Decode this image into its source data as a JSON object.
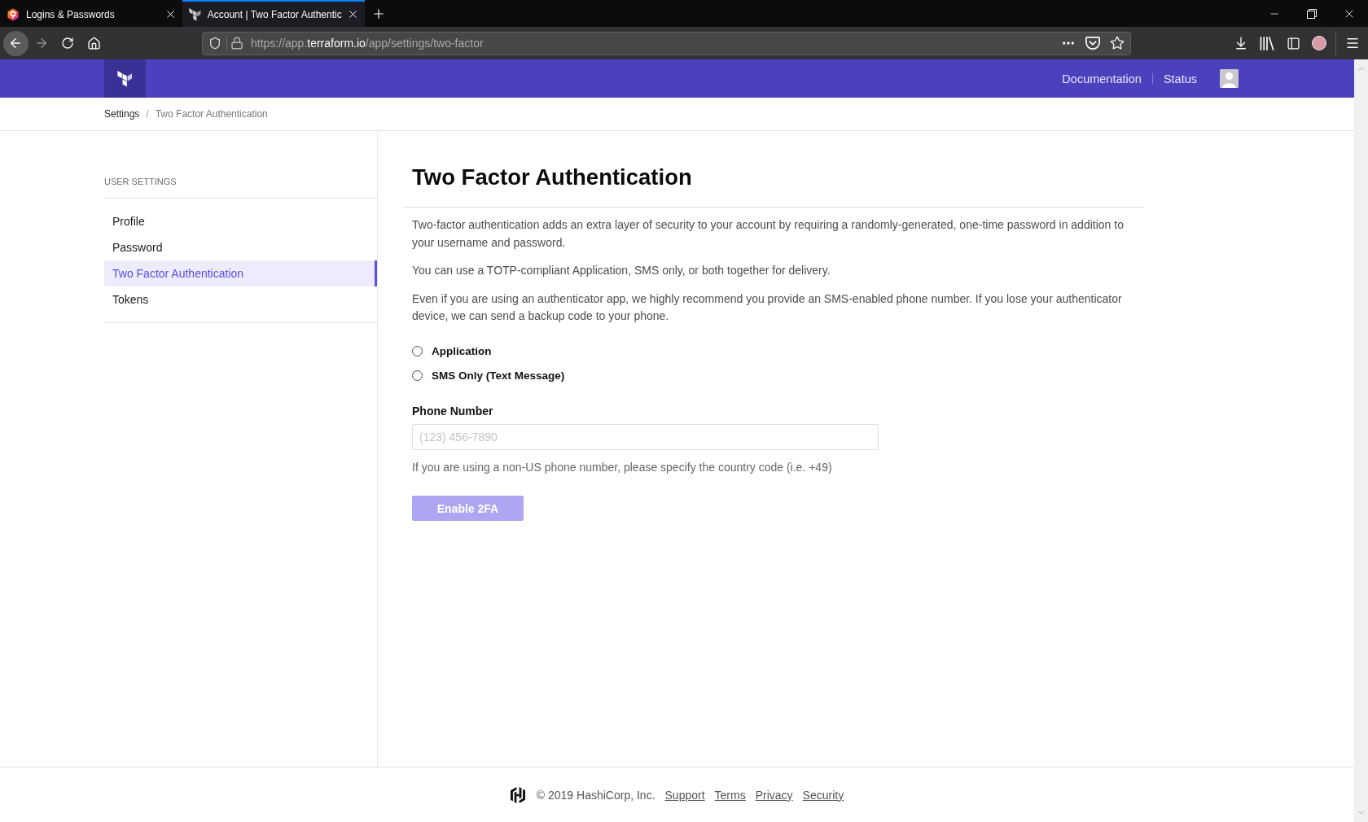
{
  "browser": {
    "tabs": [
      {
        "title": "Logins & Passwords",
        "selected": false,
        "kind": "diamond"
      },
      {
        "title": "Account | Two Factor Authentic",
        "selected": true,
        "kind": "blocks"
      }
    ],
    "url": {
      "before": "https://app.",
      "domain": "terraform.io",
      "after": "/app/settings/two-factor"
    }
  },
  "header": {
    "links": [
      "Documentation",
      "Status"
    ]
  },
  "breadcrumb": {
    "parent": "Settings",
    "separator": "/",
    "current": "Two Factor Authentication"
  },
  "sidebar": {
    "heading": "USER SETTINGS",
    "items": [
      {
        "label": "Profile",
        "selected": false
      },
      {
        "label": "Password",
        "selected": false
      },
      {
        "label": "Two Factor Authentication",
        "selected": true
      },
      {
        "label": "Tokens",
        "selected": false
      }
    ]
  },
  "main": {
    "title": "Two Factor Authentication",
    "paragraphs": [
      "Two-factor authentication adds an extra layer of security to your account by requiring a randomly-generated, one-time password in addition to your username and password.",
      "You can use a TOTP-compliant Application, SMS only, or both together for delivery.",
      "Even if you are using an authenticator app, we highly recommend you provide an SMS-enabled phone number. If you lose your authenticator device, we can send a backup code to your phone."
    ],
    "delivery_options": [
      {
        "label": "Application",
        "selected": false
      },
      {
        "label": "SMS Only (Text Message)",
        "selected": false
      }
    ],
    "phone_field": {
      "label": "Phone Number",
      "placeholder": "(123) 456-7890",
      "hint": "If you are using a non-US phone number, please specify the country code (i.e. +49)"
    },
    "submit": {
      "label": "Enable 2FA",
      "disabled": true
    }
  },
  "footer": {
    "copyright": "© 2019 HashiCorp, Inc.",
    "links": [
      "Support",
      "Terms",
      "Privacy",
      "Security"
    ]
  }
}
